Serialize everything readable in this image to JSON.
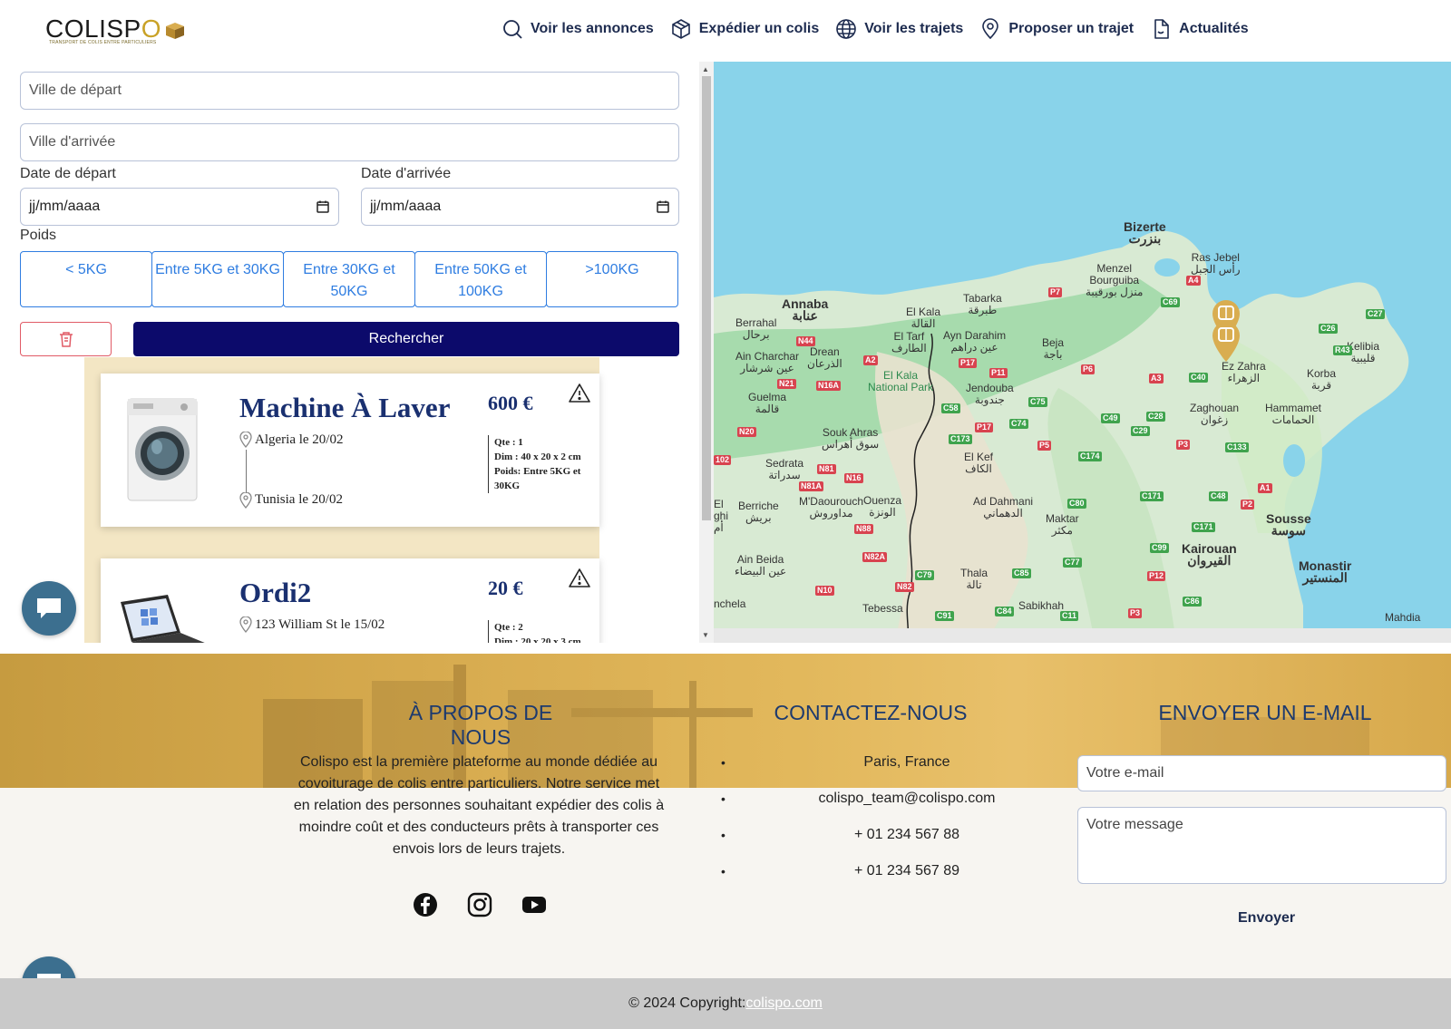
{
  "brand": {
    "name_main": "COLISP",
    "name_o": "O",
    "tagline": "TRANSPORT DE COLIS ENTRE PARTICULIERS"
  },
  "nav": [
    {
      "label": "Voir les annonces",
      "icon": "search-icon"
    },
    {
      "label": "Expédier un colis",
      "icon": "package-icon"
    },
    {
      "label": "Voir les trajets",
      "icon": "globe-icon"
    },
    {
      "label": "Proposer un trajet",
      "icon": "location-pin-icon"
    },
    {
      "label": "Actualités",
      "icon": "document-icon"
    }
  ],
  "search": {
    "departure_placeholder": "Ville de départ",
    "arrival_placeholder": "Ville d'arrivée",
    "departure_date_label": "Date de départ",
    "arrival_date_label": "Date d'arrivée",
    "date_placeholder": "jj/mm/aaaa",
    "weight_label": "Poids",
    "weights": [
      "< 5KG",
      "Entre 5KG et 30KG",
      "Entre 30KG et 50KG",
      "Entre 50KG et 100KG",
      ">100KG"
    ],
    "search_button": "Rechercher"
  },
  "listings": [
    {
      "title": "Machine À Laver",
      "price": "600 €",
      "from": "Algeria le 20/02",
      "to": "Tunisia le 20/02",
      "qty": "Qte : 1",
      "dims": "Dim : 40 x 20 x 2 cm",
      "weight": "Poids: Entre 5KG et 30KG",
      "image": "washing-machine"
    },
    {
      "title": "Ordi2",
      "price": "20 €",
      "from": "123 William St le 15/02",
      "qty": "Qte : 2",
      "dims": "Dim : 20 x 20 x 3 cm",
      "image": "laptop"
    }
  ],
  "map": {
    "labels": [
      {
        "text": "Bizerte\nبنزرت",
        "big": true
      },
      {
        "text": "Ras Jebel\nرأس الجبل"
      },
      {
        "text": "Menzel\nBourguiba\nمنزل بورقيبة"
      },
      {
        "text": "Annaba\nعنابة",
        "big": true
      },
      {
        "text": "Tabarka\nطبرقة"
      },
      {
        "text": "El Kala\nالقالة"
      },
      {
        "text": "Berrahal\nبرحال"
      },
      {
        "text": "El Tarf\nالطارف"
      },
      {
        "text": "Ayn Darahim\nعين دراهم"
      },
      {
        "text": "Beja\nباجة"
      },
      {
        "text": "Drean\nالذرعان"
      },
      {
        "text": "Ain Charchar\nعين شرشار"
      },
      {
        "text": "El Kala\nNational Park"
      },
      {
        "text": "Jendouba\nجندوبة"
      },
      {
        "text": "Ez Zahra\nالزهراء"
      },
      {
        "text": "Kelibia\nقليبية"
      },
      {
        "text": "Korba\nقربة"
      },
      {
        "text": "Guelma\nقالمة"
      },
      {
        "text": "Zaghouan\nزغوان"
      },
      {
        "text": "Hammamet\nالحمامات"
      },
      {
        "text": "Souk Ahras\nسوق أهراس"
      },
      {
        "text": "El Kef\nالكاف"
      },
      {
        "text": "Sedrata\nسدراتة"
      },
      {
        "text": "Berriche\nبريش"
      },
      {
        "text": "M'Daourouch\nمداوروش"
      },
      {
        "text": "Ouenza\nالونزة"
      },
      {
        "text": "Ad Dahmani\nالدهماني"
      },
      {
        "text": "Maktar\nمكثر"
      },
      {
        "text": "Sousse\nسوسة",
        "big": true
      },
      {
        "text": "Kairouan\nالقيروان",
        "big": true
      },
      {
        "text": "Monastir\nالمنستير",
        "big": true
      },
      {
        "text": "Ain Beida\nعين البيضاء"
      },
      {
        "text": "Thala\nتالة"
      },
      {
        "text": "Tebessa"
      },
      {
        "text": "Sabikhah"
      },
      {
        "text": "Mahdia"
      },
      {
        "text": "El\nghi\nأم"
      },
      {
        "text": "nchela"
      }
    ],
    "red_roads": [
      "P7",
      "A4",
      "P17",
      "P11",
      "A2",
      "N44",
      "N16A",
      "N21",
      "N20",
      "P6",
      "P17",
      "P5",
      "A3",
      "P3",
      "P2",
      "A1",
      "P12",
      "P3",
      "N81",
      "N81A",
      "N16",
      "N88",
      "N82A",
      "N82",
      "N10",
      "102"
    ],
    "green_roads": [
      "C69",
      "C27",
      "C26",
      "R43",
      "C40",
      "C75",
      "C58",
      "C74",
      "C49",
      "C28",
      "C29",
      "C173",
      "C174",
      "C133",
      "C171",
      "C48",
      "C80",
      "C171",
      "C99",
      "C77",
      "C85",
      "C79",
      "C86",
      "C84",
      "C91",
      "C11"
    ]
  },
  "footer": {
    "about_title": "À PROPOS DE NOUS",
    "about_text": "Colispo est la première plateforme au monde dédiée au covoiturage de colis entre particuliers. Notre service met en relation des personnes souhaitant expédier des colis à moindre coût et des conducteurs prêts à transporter ces envois lors de leurs trajets.",
    "contact_title": "CONTACTEZ-NOUS",
    "contacts": [
      "Paris, France",
      "colispo_team@colispo.com",
      "+ 01 234 567 88",
      "+ 01 234 567 89"
    ],
    "email_title": "ENVOYER UN E-MAIL",
    "email_placeholder": "Votre e-mail",
    "message_placeholder": "Votre message",
    "send_label": "Envoyer",
    "socials": [
      "facebook-icon",
      "instagram-icon",
      "youtube-icon"
    ]
  },
  "copyright": {
    "text": "© 2024 Copyright:",
    "link": "colispo.com"
  },
  "colors": {
    "primary_dark": "#0c0a6b",
    "blue_accent": "#2f7de1",
    "danger": "#e15b66",
    "gold": "#d9ad50",
    "title_blue": "#1a3070"
  }
}
